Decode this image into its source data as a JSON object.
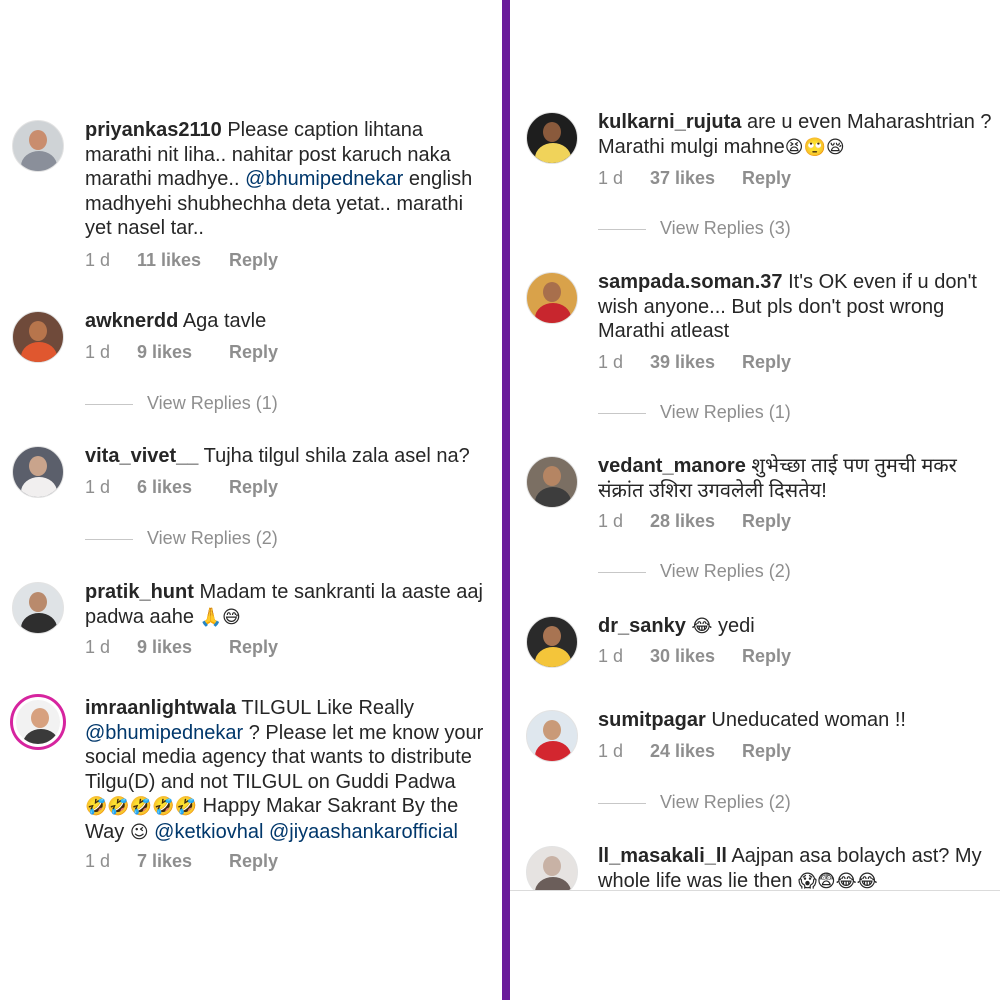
{
  "left": {
    "comments": [
      {
        "username": "priyankas2110",
        "lines": [
          "Please caption lihtana",
          "marathi nit liha.. nahitar post karuch naka",
          "marathi madhye.. ",
          "@bhumipednekar",
          " english",
          "madhyehi shubhechha deta yetat.. marathi",
          "yet nasel tar.."
        ],
        "time": "1 d",
        "likes": "11 likes",
        "reply": "Reply",
        "avatar_colors": {
          "skin": "#c98d6e",
          "body": "#8a8f9a",
          "bg": "#cfd3d6"
        }
      },
      {
        "username": "awknerdd",
        "text": "Aga tavle",
        "time": "1 d",
        "likes": "9 likes",
        "reply": "Reply",
        "view_replies": "View Replies (1)",
        "avatar_colors": {
          "skin": "#b7754c",
          "body": "#e0572f",
          "bg": "#6f4a3a"
        }
      },
      {
        "username": "vita_vivet__",
        "text": "Tujha tilgul shila zala asel na?",
        "time": "1 d",
        "likes": "6 likes",
        "reply": "Reply",
        "view_replies": "View Replies (2)",
        "avatar_colors": {
          "skin": "#c9a48c",
          "body": "#f1efef",
          "bg": "#5b5f6b"
        }
      },
      {
        "username": "pratik_hunt",
        "line1": "Madam te sankranti la aaste aaj",
        "line2": "padwa aahe",
        "emoji": "🙏😅",
        "time": "1 d",
        "likes": "9 likes",
        "reply": "Reply",
        "avatar_colors": {
          "skin": "#b98a6c",
          "body": "#2e2e2e",
          "bg": "#dfe3e6"
        }
      },
      {
        "username": "imraanlightwala",
        "line1": "TILGUL Like Really",
        "mention1": "@bhumipednekar",
        "line2_rest": " ? Please let me know your",
        "line3": "social media agency that wants to distribute",
        "line4": "Tilgu(D) and not TILGUL on Guddi Padwa",
        "line5_emoji": "🤣🤣🤣🤣🤣",
        "line5_text": " Happy Makar Sakrant By the",
        "line6_text": "Way ",
        "line6_emoji": "😉",
        "mention2": "@ketkiovhal",
        "mention3": "@jiyaashankarofficial",
        "time": "1 d",
        "likes": "7 likes",
        "reply": "Reply",
        "avatar_colors": {
          "skin": "#d7a17f",
          "body": "#3a3a3a",
          "bg": "#f2f2f2",
          "ring": "#d6249f"
        }
      }
    ]
  },
  "right": {
    "comments": [
      {
        "username": "kulkarni_rujuta",
        "line1": "are u even Maharashtrian ?",
        "line2": "Marathi mulgi mahne",
        "emoji": "😫🙄😪",
        "time": "1 d",
        "likes": "37 likes",
        "reply": "Reply",
        "view_replies": "View Replies (3)",
        "avatar_colors": {
          "skin": "#8a5a3c",
          "body": "#f0d35a",
          "bg": "#1e1e1e"
        }
      },
      {
        "username": "sampada.soman.37",
        "line1": "It's OK even if u don't",
        "line2": "wish anyone... But pls don't post wrong",
        "line3": "Marathi atleast",
        "time": "1 d",
        "likes": "39 likes",
        "reply": "Reply",
        "view_replies": "View Replies (1)",
        "avatar_colors": {
          "skin": "#a86f4c",
          "body": "#c8262e",
          "bg": "#d9a24a"
        }
      },
      {
        "username": "vedant_manore",
        "line1": "शुभेच्छा ताई पण तुमची मकर",
        "line2": "संक्रांत उशिरा उगवलेली दिसतेय!",
        "time": "1 d",
        "likes": "28 likes",
        "reply": "Reply",
        "view_replies": "View Replies (2)",
        "avatar_colors": {
          "skin": "#b58563",
          "body": "#3d3d3d",
          "bg": "#7b6f63"
        }
      },
      {
        "username": "dr_sanky",
        "emoji": "😂",
        "text": "yedi",
        "time": "1 d",
        "likes": "30 likes",
        "reply": "Reply",
        "avatar_colors": {
          "skin": "#a87452",
          "body": "#f4c53a",
          "bg": "#2a2a2a"
        }
      },
      {
        "username": "sumitpagar",
        "text": "Uneducated woman !!",
        "time": "1 d",
        "likes": "24 likes",
        "reply": "Reply",
        "view_replies": "View Replies (2)",
        "avatar_colors": {
          "skin": "#c99a78",
          "body": "#d3262f",
          "bg": "#dfe7ee"
        }
      },
      {
        "username": "ll_masakali_ll",
        "line1": "Aajpan asa bolaych ast? My",
        "line2_text": "whole life was lie then ",
        "line2_emoji": "😱😨😂😂",
        "avatar_colors": {
          "skin": "#c8b2a5",
          "body": "#6b5e5a",
          "bg": "#e6e3e1"
        }
      }
    ]
  }
}
